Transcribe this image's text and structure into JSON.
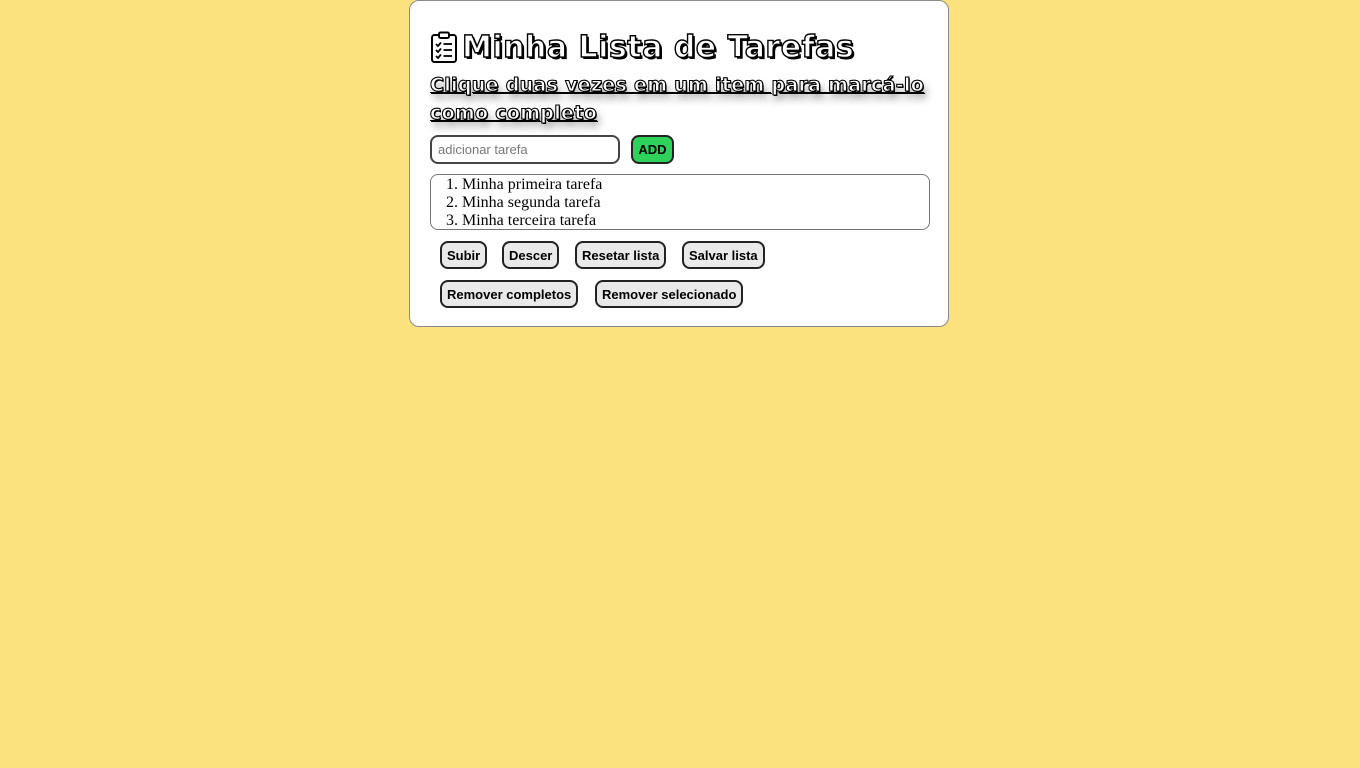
{
  "header": {
    "icon": "clipboard-list-icon",
    "title": "Minha Lista de Tarefas",
    "subtitle": "Clique duas vezes em um item para marcá-lo como completo"
  },
  "form": {
    "input_value": "",
    "input_placeholder": "adicionar tarefa",
    "add_label": "ADD"
  },
  "tasks": [
    "Minha primeira tarefa",
    "Minha segunda tarefa",
    "Minha terceira tarefa"
  ],
  "controls": {
    "up_label": "Subir",
    "down_label": "Descer",
    "reset_label": "Resetar lista",
    "save_label": "Salvar lista",
    "remove_completed_label": "Remover completos",
    "remove_selected_label": "Remover selecionado"
  },
  "colors": {
    "background": "#fce17f",
    "card": "#ffffff",
    "add_button": "#2ed25a",
    "button": "#e9e9e9"
  }
}
